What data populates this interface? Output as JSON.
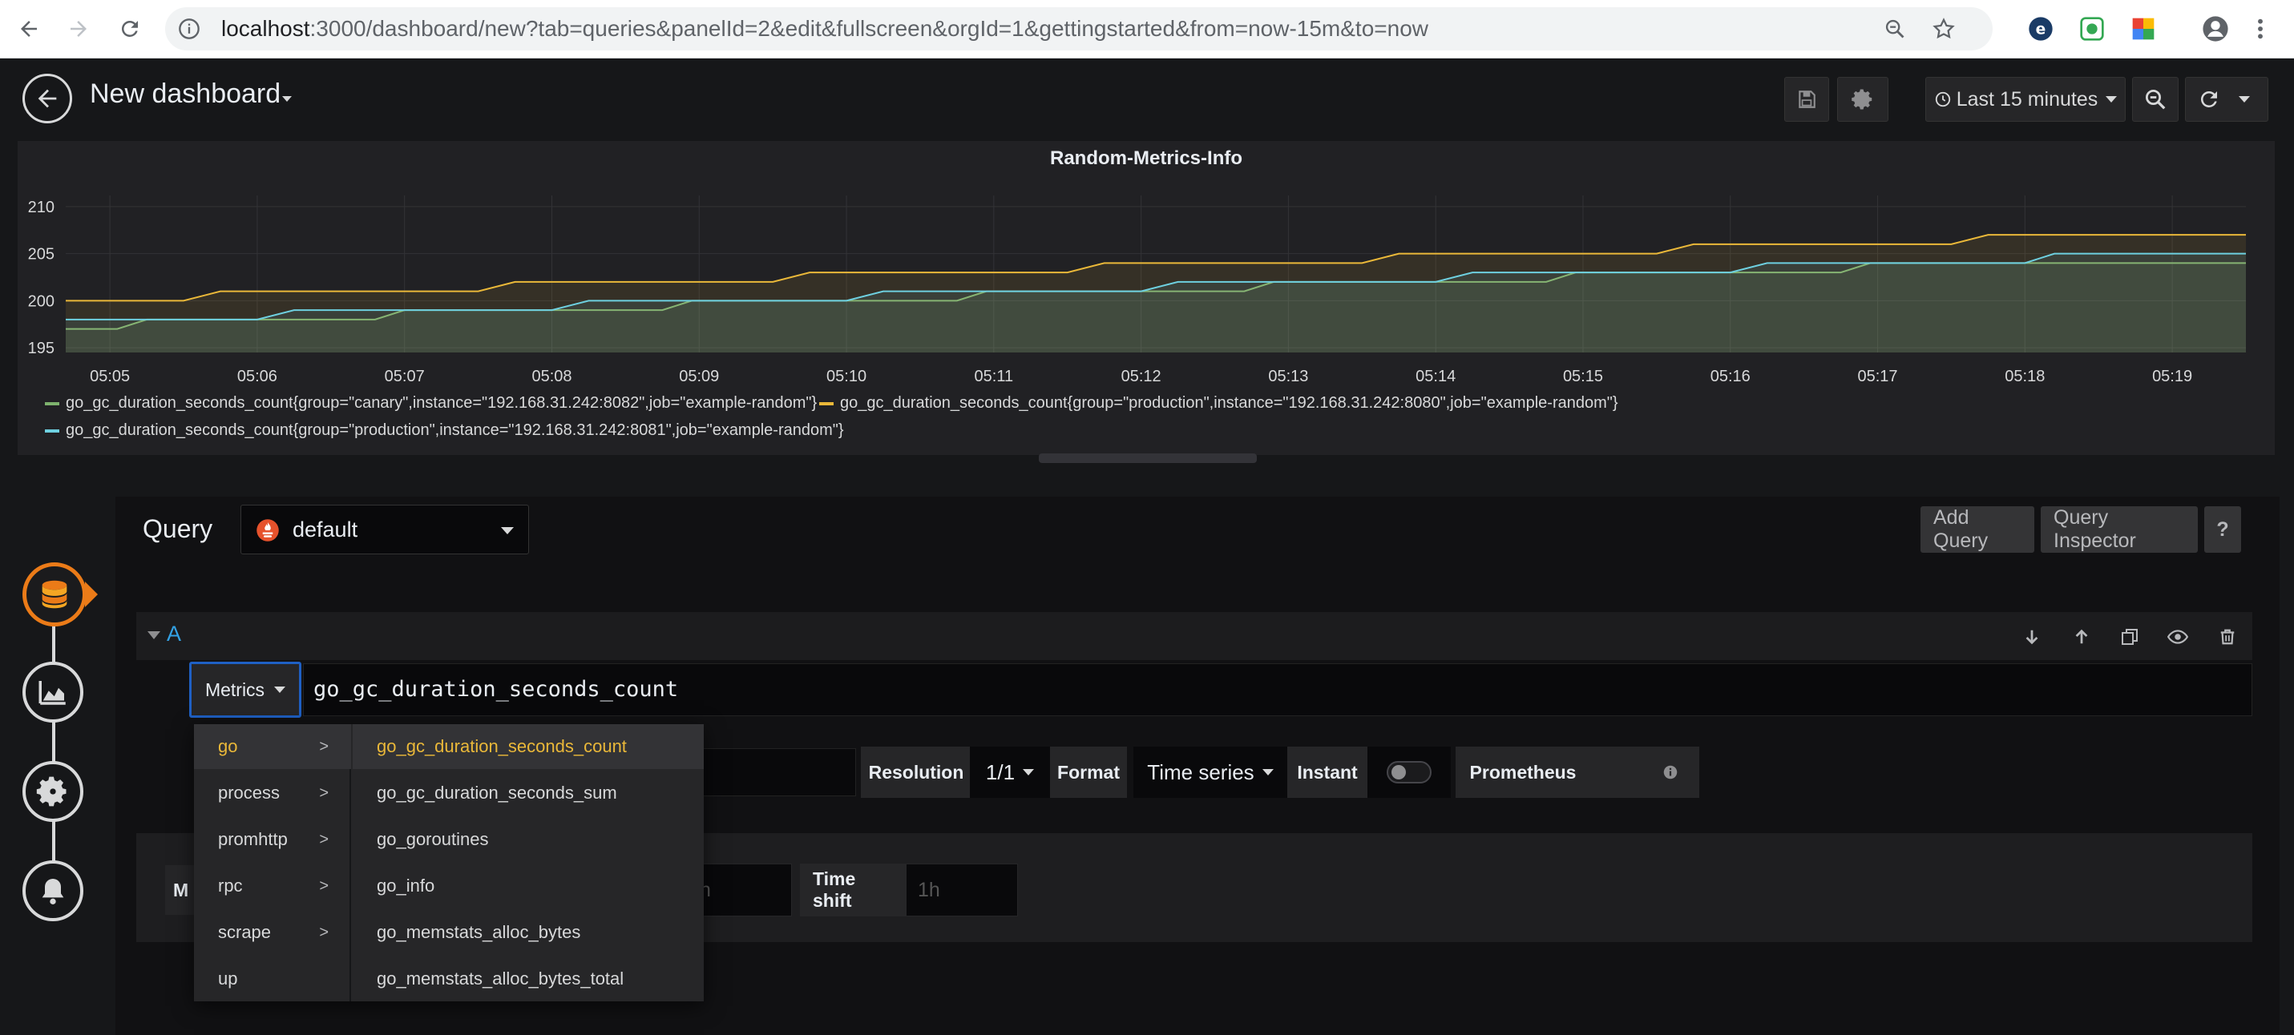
{
  "browser": {
    "url_main": "localhost",
    "url_rest": ":3000/dashboard/new?tab=queries&panelId=2&edit&fullscreen&orgId=1&gettingstarted&from=now-15m&to=now"
  },
  "topbar": {
    "dashboard_title": "New dashboard",
    "time_range": "Last 15 minutes"
  },
  "panel": {
    "title": "Random-Metrics-Info",
    "legend": [
      "go_gc_duration_seconds_count{group=\"canary\",instance=\"192.168.31.242:8082\",job=\"example-random\"}",
      "go_gc_duration_seconds_count{group=\"production\",instance=\"192.168.31.242:8080\",job=\"example-random\"}",
      "go_gc_duration_seconds_count{group=\"production\",instance=\"192.168.31.242:8081\",job=\"example-random\"}"
    ]
  },
  "chart_data": {
    "type": "line",
    "title": "Random-Metrics-Info",
    "x_ticks": [
      "05:05",
      "05:06",
      "05:07",
      "05:08",
      "05:09",
      "05:10",
      "05:11",
      "05:12",
      "05:13",
      "05:14",
      "05:15",
      "05:16",
      "05:17",
      "05:18",
      "05:19"
    ],
    "y_ticks": [
      195,
      200,
      205,
      210
    ],
    "ylim": [
      194.5,
      210.5
    ],
    "xlim": [
      "05:04.7",
      "05:19.5"
    ],
    "grid": true,
    "legend_position": "bottom",
    "series": [
      {
        "name": "go_gc_duration_seconds_count{group=\"canary\",instance=\"192.168.31.242:8082\",job=\"example-random\"}",
        "color": "#7eb26d",
        "points": [
          [
            4.7,
            197
          ],
          [
            5.05,
            197
          ],
          [
            5.25,
            198
          ],
          [
            6.8,
            198
          ],
          [
            7.0,
            199
          ],
          [
            8.75,
            199
          ],
          [
            8.95,
            200
          ],
          [
            10.75,
            200
          ],
          [
            10.95,
            201
          ],
          [
            12.7,
            201
          ],
          [
            12.9,
            202
          ],
          [
            14.75,
            202
          ],
          [
            14.95,
            203
          ],
          [
            16.75,
            203
          ],
          [
            16.95,
            204
          ],
          [
            19.5,
            204
          ]
        ]
      },
      {
        "name": "go_gc_duration_seconds_count{group=\"production\",instance=\"192.168.31.242:8080\",job=\"example-random\"}",
        "color": "#eab839",
        "points": [
          [
            4.7,
            200
          ],
          [
            5.5,
            200
          ],
          [
            5.75,
            201
          ],
          [
            7.5,
            201
          ],
          [
            7.75,
            202
          ],
          [
            9.5,
            202
          ],
          [
            9.75,
            203
          ],
          [
            11.5,
            203
          ],
          [
            11.75,
            204
          ],
          [
            13.5,
            204
          ],
          [
            13.75,
            205
          ],
          [
            15.5,
            205
          ],
          [
            15.75,
            206
          ],
          [
            17.5,
            206
          ],
          [
            17.75,
            207
          ],
          [
            19.5,
            207
          ]
        ]
      },
      {
        "name": "go_gc_duration_seconds_count{group=\"production\",instance=\"192.168.31.242:8081\",job=\"example-random\"}",
        "color": "#6ed0e0",
        "points": [
          [
            4.7,
            198
          ],
          [
            6.0,
            198
          ],
          [
            6.25,
            199
          ],
          [
            8.0,
            199
          ],
          [
            8.25,
            200
          ],
          [
            10.0,
            200
          ],
          [
            10.25,
            201
          ],
          [
            12.0,
            201
          ],
          [
            12.25,
            202
          ],
          [
            14.0,
            202
          ],
          [
            14.25,
            203
          ],
          [
            16.0,
            203
          ],
          [
            16.25,
            204
          ],
          [
            18.0,
            204
          ],
          [
            18.2,
            205
          ],
          [
            19.5,
            205
          ]
        ]
      }
    ]
  },
  "query": {
    "title": "Query",
    "datasource": "default",
    "add_query": "Add Query",
    "inspector": "Query Inspector",
    "help": "?",
    "row_label": "A",
    "metrics_btn": "Metrics",
    "expression": "go_gc_duration_seconds_count",
    "resolution_label": "Resolution",
    "resolution_value": "1/1",
    "format_label": "Format",
    "format_value": "Time series",
    "instant_label": "Instant",
    "prometheus_link": "Prometheus",
    "min_label": "M",
    "timeshift_label": "Time shift",
    "timeshift_placeholder": "1h",
    "other_placeholder": "h"
  },
  "dropdown": {
    "categories": [
      "go",
      "process",
      "promhttp",
      "rpc",
      "scrape",
      "up"
    ],
    "metrics": [
      "go_gc_duration_seconds_count",
      "go_gc_duration_seconds_sum",
      "go_goroutines",
      "go_info",
      "go_memstats_alloc_bytes",
      "go_memstats_alloc_bytes_total"
    ]
  }
}
